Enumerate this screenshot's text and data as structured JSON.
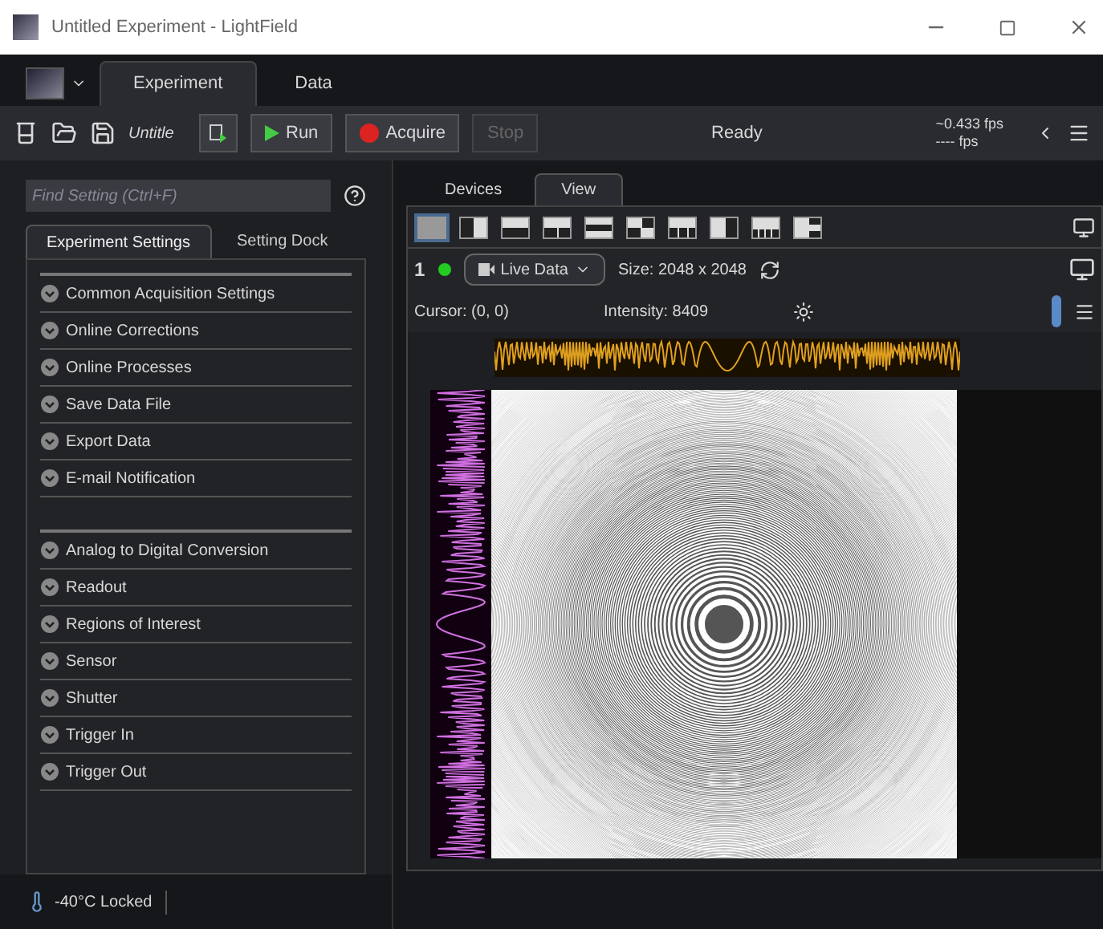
{
  "window": {
    "title": "Untitled Experiment - LightField"
  },
  "ribbon_tabs": [
    {
      "label": "Experiment",
      "selected": true
    },
    {
      "label": "Data",
      "selected": false
    }
  ],
  "toolbar": {
    "file_name": "Untitle",
    "run": "Run",
    "acquire": "Acquire",
    "stop": "Stop",
    "status": "Ready",
    "rate_1": "~0.433 fps",
    "rate_2": "---- fps"
  },
  "search": {
    "placeholder": "Find Setting (Ctrl+F)"
  },
  "panel_tabs": [
    {
      "label": "Experiment Settings",
      "selected": true
    },
    {
      "label": "Setting Dock",
      "selected": false
    }
  ],
  "setting_groups": [
    [
      "Common Acquisition Settings",
      "Online Corrections",
      "Online Processes",
      "Save Data File",
      "Export Data",
      "E-mail Notification"
    ],
    [
      "Analog to Digital Conversion",
      "Readout",
      "Regions of Interest",
      "Sensor",
      "Shutter",
      "Trigger In",
      "Trigger Out"
    ]
  ],
  "view_tabs": [
    {
      "label": "Devices",
      "selected": false
    },
    {
      "label": "View",
      "selected": true
    }
  ],
  "layouts": [
    {
      "selected": true
    },
    {
      "selected": false
    },
    {
      "selected": false
    },
    {
      "selected": false
    },
    {
      "selected": false
    },
    {
      "selected": false
    },
    {
      "selected": false
    },
    {
      "selected": false
    },
    {
      "selected": false
    },
    {
      "selected": false
    }
  ],
  "display": {
    "index": "1",
    "source": "Live Data",
    "size": "Size: 2048 x 2048",
    "cursor": "Cursor: (0, 0)",
    "intensity": "Intensity: 8409"
  },
  "status_bar": {
    "temperature": "-40°C Locked"
  }
}
